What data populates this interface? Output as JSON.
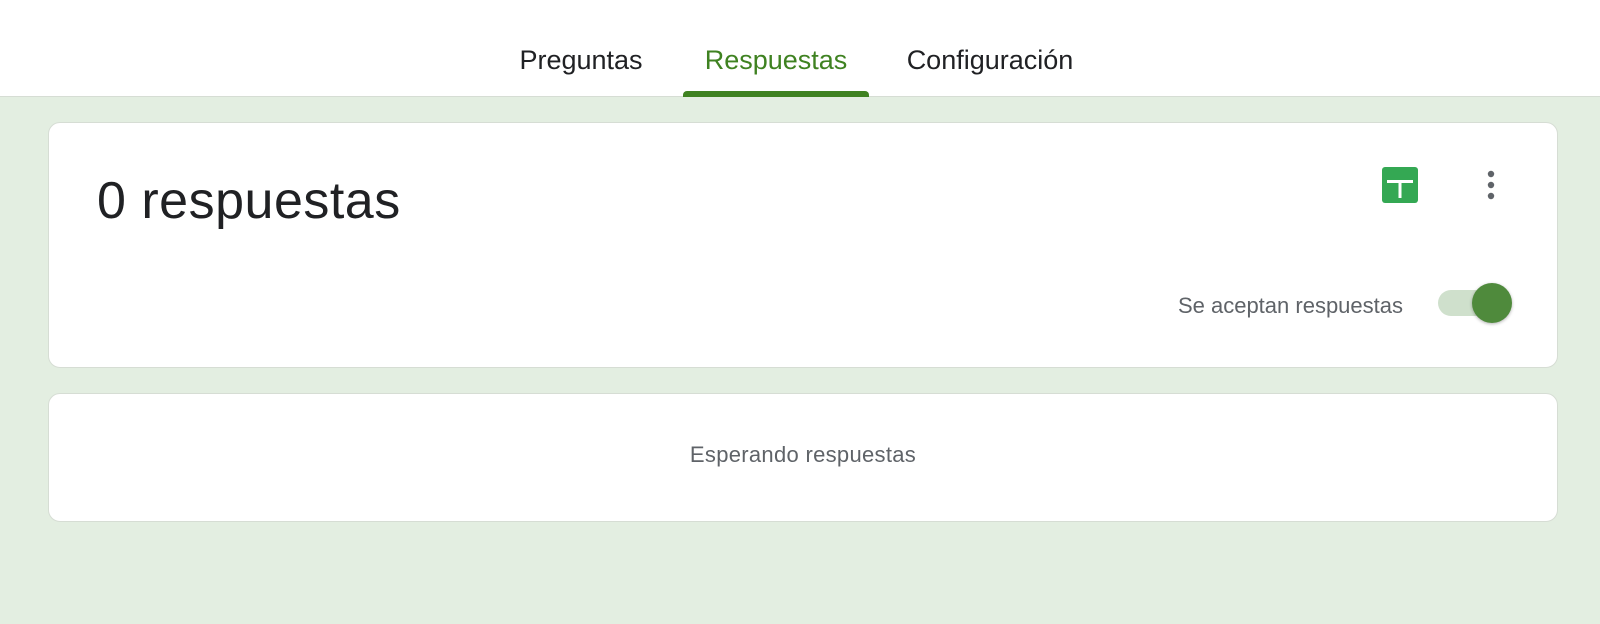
{
  "tabs": [
    {
      "label": "Preguntas",
      "active": false
    },
    {
      "label": "Respuestas",
      "active": true
    },
    {
      "label": "Configuración",
      "active": false
    }
  ],
  "summary": {
    "count_text": "0 respuestas",
    "accepting_label": "Se aceptan respuestas",
    "accepting_enabled": true,
    "link_sheets_icon": "google-sheets-icon",
    "more_icon": "more-vert-icon"
  },
  "empty_state": {
    "text": "Esperando respuestas"
  },
  "colors": {
    "accent": "#3f8221",
    "background": "#e3eee1",
    "sheets_green": "#34a853",
    "toggle_thumb": "#4f8a3c",
    "toggle_track": "#cfe0cc"
  }
}
